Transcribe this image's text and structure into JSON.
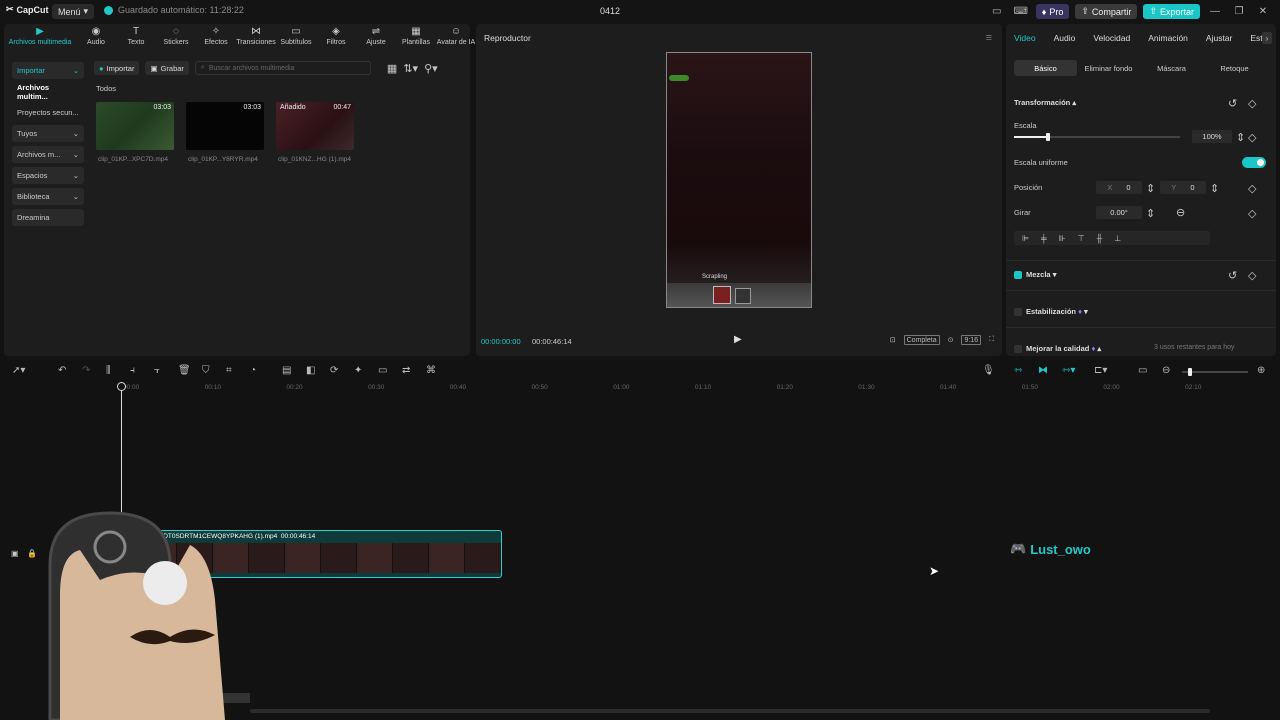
{
  "titlebar": {
    "app_name": "CapCut",
    "menu_label": "Menú",
    "autosave": "Guardado automático: 11:28:22",
    "project_title": "0412",
    "pro_label": "Pro",
    "share_label": "Compartir",
    "export_label": "Exportar"
  },
  "media_tabs": [
    {
      "label": "Archivos multimedia",
      "icon": "media-icon"
    },
    {
      "label": "Audio",
      "icon": "audio-icon"
    },
    {
      "label": "Texto",
      "icon": "text-icon"
    },
    {
      "label": "Stickers",
      "icon": "sticker-icon"
    },
    {
      "label": "Efectos",
      "icon": "effects-icon"
    },
    {
      "label": "Transiciones",
      "icon": "transition-icon"
    },
    {
      "label": "Subtítulos",
      "icon": "subtitle-icon"
    },
    {
      "label": "Filtros",
      "icon": "filter-icon"
    },
    {
      "label": "Ajuste",
      "icon": "adjust-icon"
    },
    {
      "label": "Plantillas",
      "icon": "template-icon"
    },
    {
      "label": "Avatar de IA",
      "icon": "avatar-icon"
    }
  ],
  "media_sidebar": [
    "Importar",
    "Archivos multim...",
    "Proyectos secun...",
    "Tuyos",
    "Archivos m...",
    "Espacios",
    "Biblioteca",
    "Dreamina"
  ],
  "media_toolbar": {
    "import_label": "Importar",
    "record_label": "Grabar",
    "search_placeholder": "Buscar archivos multimedia"
  },
  "media_section": "Todos",
  "clips": [
    {
      "name": "clip_01KP...XPC7D.mp4",
      "duration": "03:03",
      "badge": ""
    },
    {
      "name": "clip_01KP...Y8RYR.mp4",
      "duration": "03:03",
      "badge": ""
    },
    {
      "name": "clip_01KNZ...HG (1).mp4",
      "duration": "00:47",
      "badge": "Añadido"
    }
  ],
  "player": {
    "title": "Reproductor",
    "current_time": "00:00:00:00",
    "total_time": "00:00:46:14",
    "watermark": "Scrapling",
    "full_label": "Completa",
    "ratio_label": "9:16"
  },
  "inspector": {
    "tabs": [
      "Video",
      "Audio",
      "Velocidad",
      "Animación",
      "Ajustar",
      "Est"
    ],
    "subtabs": [
      "Básico",
      "Eliminar fondo",
      "Máscara",
      "Retoque"
    ],
    "transform_label": "Transformación",
    "scale_label": "Escala",
    "scale_value": "100%",
    "uniform_scale_label": "Escala uniforme",
    "position_label": "Posición",
    "pos_x_label": "X",
    "pos_x": "0",
    "pos_y_label": "Y",
    "pos_y": "0",
    "rotate_label": "Girar",
    "rotate_value": "0.00°",
    "blend_label": "Mezcla",
    "stabilize_label": "Estabilización",
    "quality_label": "Mejorar la calidad",
    "quality_note": "3 usos restantes para hoy"
  },
  "timeline": {
    "ruler": [
      "00:00",
      "00:10",
      "00:20",
      "00:30",
      "00:40",
      "00:50",
      "01:00",
      "01:10",
      "01:20",
      "01:30",
      "01:40",
      "01:50",
      "02:00",
      "02:10"
    ],
    "clip_label": "1KNZ3DT0SDRTM1CEWQ8YPKAHG (1).mp4",
    "clip_duration": "00:00:46:14"
  },
  "overlay": {
    "streamer_name": "Lust_owo"
  },
  "colors": {
    "accent": "#21c9c9",
    "panel": "#1d1d1d",
    "background": "#121212"
  }
}
